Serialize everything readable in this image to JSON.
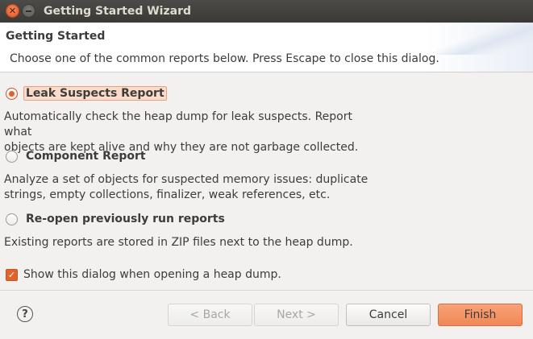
{
  "window": {
    "title": "Getting Started Wizard"
  },
  "header": {
    "title": "Getting Started",
    "message": "Choose one of the common reports below. Press Escape to close this dialog."
  },
  "options": [
    {
      "label": "Leak Suspects Report",
      "selected": true,
      "description_line1": "Automatically check the heap dump for leak suspects. Report what",
      "description_line2": "objects are kept alive and why they are not garbage collected."
    },
    {
      "label": "Component Report",
      "selected": false,
      "description_line1": "Analyze a set of objects for suspected memory issues: duplicate",
      "description_line2": "strings, empty collections, finalizer, weak references, etc."
    },
    {
      "label": "Re-open previously run reports",
      "selected": false,
      "description_line1": "Existing reports are stored in ZIP files next to the heap dump."
    }
  ],
  "show_dialog_checkbox": {
    "label": "Show this dialog when opening a heap dump.",
    "checked": true
  },
  "footer": {
    "help_glyph": "?",
    "back_label": "< Back",
    "next_label": "Next >",
    "cancel_label": "Cancel",
    "finish_label": "Finish"
  },
  "colors": {
    "accent": "#e1632a",
    "titlebar": "#3c3b37",
    "background": "#f2f1f0"
  }
}
